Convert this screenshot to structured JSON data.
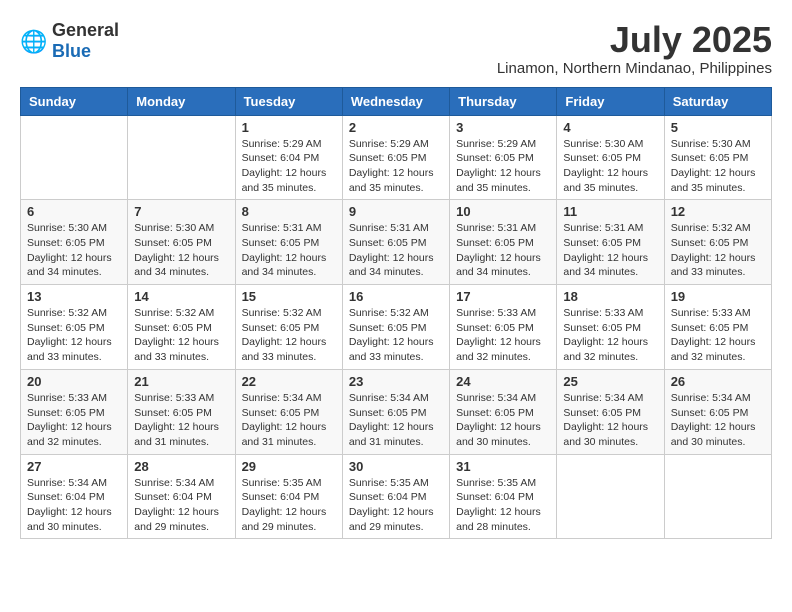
{
  "logo": {
    "general": "General",
    "blue": "Blue"
  },
  "header": {
    "month": "July 2025",
    "location": "Linamon, Northern Mindanao, Philippines"
  },
  "weekdays": [
    "Sunday",
    "Monday",
    "Tuesday",
    "Wednesday",
    "Thursday",
    "Friday",
    "Saturday"
  ],
  "weeks": [
    [
      {
        "day": "",
        "info": ""
      },
      {
        "day": "",
        "info": ""
      },
      {
        "day": "1",
        "info": "Sunrise: 5:29 AM\nSunset: 6:04 PM\nDaylight: 12 hours and 35 minutes."
      },
      {
        "day": "2",
        "info": "Sunrise: 5:29 AM\nSunset: 6:05 PM\nDaylight: 12 hours and 35 minutes."
      },
      {
        "day": "3",
        "info": "Sunrise: 5:29 AM\nSunset: 6:05 PM\nDaylight: 12 hours and 35 minutes."
      },
      {
        "day": "4",
        "info": "Sunrise: 5:30 AM\nSunset: 6:05 PM\nDaylight: 12 hours and 35 minutes."
      },
      {
        "day": "5",
        "info": "Sunrise: 5:30 AM\nSunset: 6:05 PM\nDaylight: 12 hours and 35 minutes."
      }
    ],
    [
      {
        "day": "6",
        "info": "Sunrise: 5:30 AM\nSunset: 6:05 PM\nDaylight: 12 hours and 34 minutes."
      },
      {
        "day": "7",
        "info": "Sunrise: 5:30 AM\nSunset: 6:05 PM\nDaylight: 12 hours and 34 minutes."
      },
      {
        "day": "8",
        "info": "Sunrise: 5:31 AM\nSunset: 6:05 PM\nDaylight: 12 hours and 34 minutes."
      },
      {
        "day": "9",
        "info": "Sunrise: 5:31 AM\nSunset: 6:05 PM\nDaylight: 12 hours and 34 minutes."
      },
      {
        "day": "10",
        "info": "Sunrise: 5:31 AM\nSunset: 6:05 PM\nDaylight: 12 hours and 34 minutes."
      },
      {
        "day": "11",
        "info": "Sunrise: 5:31 AM\nSunset: 6:05 PM\nDaylight: 12 hours and 34 minutes."
      },
      {
        "day": "12",
        "info": "Sunrise: 5:32 AM\nSunset: 6:05 PM\nDaylight: 12 hours and 33 minutes."
      }
    ],
    [
      {
        "day": "13",
        "info": "Sunrise: 5:32 AM\nSunset: 6:05 PM\nDaylight: 12 hours and 33 minutes."
      },
      {
        "day": "14",
        "info": "Sunrise: 5:32 AM\nSunset: 6:05 PM\nDaylight: 12 hours and 33 minutes."
      },
      {
        "day": "15",
        "info": "Sunrise: 5:32 AM\nSunset: 6:05 PM\nDaylight: 12 hours and 33 minutes."
      },
      {
        "day": "16",
        "info": "Sunrise: 5:32 AM\nSunset: 6:05 PM\nDaylight: 12 hours and 33 minutes."
      },
      {
        "day": "17",
        "info": "Sunrise: 5:33 AM\nSunset: 6:05 PM\nDaylight: 12 hours and 32 minutes."
      },
      {
        "day": "18",
        "info": "Sunrise: 5:33 AM\nSunset: 6:05 PM\nDaylight: 12 hours and 32 minutes."
      },
      {
        "day": "19",
        "info": "Sunrise: 5:33 AM\nSunset: 6:05 PM\nDaylight: 12 hours and 32 minutes."
      }
    ],
    [
      {
        "day": "20",
        "info": "Sunrise: 5:33 AM\nSunset: 6:05 PM\nDaylight: 12 hours and 32 minutes."
      },
      {
        "day": "21",
        "info": "Sunrise: 5:33 AM\nSunset: 6:05 PM\nDaylight: 12 hours and 31 minutes."
      },
      {
        "day": "22",
        "info": "Sunrise: 5:34 AM\nSunset: 6:05 PM\nDaylight: 12 hours and 31 minutes."
      },
      {
        "day": "23",
        "info": "Sunrise: 5:34 AM\nSunset: 6:05 PM\nDaylight: 12 hours and 31 minutes."
      },
      {
        "day": "24",
        "info": "Sunrise: 5:34 AM\nSunset: 6:05 PM\nDaylight: 12 hours and 30 minutes."
      },
      {
        "day": "25",
        "info": "Sunrise: 5:34 AM\nSunset: 6:05 PM\nDaylight: 12 hours and 30 minutes."
      },
      {
        "day": "26",
        "info": "Sunrise: 5:34 AM\nSunset: 6:05 PM\nDaylight: 12 hours and 30 minutes."
      }
    ],
    [
      {
        "day": "27",
        "info": "Sunrise: 5:34 AM\nSunset: 6:04 PM\nDaylight: 12 hours and 30 minutes."
      },
      {
        "day": "28",
        "info": "Sunrise: 5:34 AM\nSunset: 6:04 PM\nDaylight: 12 hours and 29 minutes."
      },
      {
        "day": "29",
        "info": "Sunrise: 5:35 AM\nSunset: 6:04 PM\nDaylight: 12 hours and 29 minutes."
      },
      {
        "day": "30",
        "info": "Sunrise: 5:35 AM\nSunset: 6:04 PM\nDaylight: 12 hours and 29 minutes."
      },
      {
        "day": "31",
        "info": "Sunrise: 5:35 AM\nSunset: 6:04 PM\nDaylight: 12 hours and 28 minutes."
      },
      {
        "day": "",
        "info": ""
      },
      {
        "day": "",
        "info": ""
      }
    ]
  ]
}
